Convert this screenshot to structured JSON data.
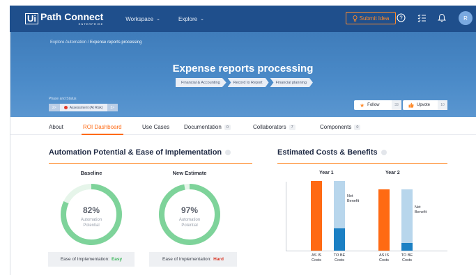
{
  "header": {
    "logo_box": "Ui",
    "logo_main": "Path Connect",
    "logo_sub": "ENTERPRISE",
    "nav": [
      {
        "label": "Workspace",
        "chevron": "⌄"
      },
      {
        "label": "Explore",
        "chevron": "⌄"
      }
    ],
    "submit_idea": "Submit Idea",
    "avatar_initial": "R",
    "icons": [
      "lightbulb-icon",
      "help-icon",
      "checklist-icon",
      "bell-icon"
    ]
  },
  "hero": {
    "breadcrumb_parent": "Explore Automation /",
    "breadcrumb_current": "Expense reports processing",
    "title": "Expense reports processing",
    "tags": [
      "Financial & Accounting",
      "Record to Report",
      "Financial planning"
    ],
    "phase_label": "Phase and Status",
    "phase_prev": "2>",
    "phase_current": "Assessment (At Risk)",
    "phase_next": "3>",
    "follow_label": "Follow",
    "follow_count": "33",
    "upvote_label": "Upvote",
    "upvote_count": "10"
  },
  "tabs": [
    {
      "label": "About",
      "count": ""
    },
    {
      "label": "ROI Dashboard",
      "count": ""
    },
    {
      "label": "Use Cases",
      "count": ""
    },
    {
      "label": "Documentation",
      "count": "0"
    },
    {
      "label": "Collaborators",
      "count": "7"
    },
    {
      "label": "Components",
      "count": "0"
    }
  ],
  "automation": {
    "title": "Automation Potential & Ease of Implementation",
    "baseline": {
      "label": "Baseline",
      "percent": "82%",
      "sub1": "Automation",
      "sub2": "Potential",
      "value": 0.82,
      "ease_label": "Ease of Implementation:",
      "ease_value": "Easy"
    },
    "estimate": {
      "label": "New Estimate",
      "percent": "97%",
      "sub1": "Automation",
      "sub2": "Potential",
      "value": 0.97,
      "ease_label": "Ease of Implementation:",
      "ease_value": "Hard"
    }
  },
  "costs": {
    "title": "Estimated Costs & Benefits",
    "year1": "Year 1",
    "year2": "Year 2",
    "net_benefit_1": "Net",
    "net_benefit_2": "Benefit",
    "as_is_1": "AS IS",
    "as_is_2": "Costs",
    "to_be_1": "TO BE",
    "to_be_2": "Costs"
  },
  "chart_data": {
    "type": "bar",
    "title": "Estimated Costs & Benefits",
    "categories": [
      "Year 1",
      "Year 2"
    ],
    "series": [
      {
        "name": "AS IS Costs",
        "values": [
          1.0,
          0.88
        ]
      },
      {
        "name": "TO BE Costs",
        "values": [
          0.32,
          0.11
        ]
      },
      {
        "name": "Net Benefit",
        "values": [
          0.68,
          0.77
        ]
      }
    ],
    "ylim": [
      0,
      1
    ],
    "colors": {
      "as_is": "#ff6a13",
      "to_be": "#1b80c4",
      "net": "#b8d6ec"
    }
  },
  "colors": {
    "nav": "#1f4f8c",
    "accent": "#ff6a13",
    "gauge": "#7ed39a",
    "gauge_track": "#e6f5ea"
  }
}
